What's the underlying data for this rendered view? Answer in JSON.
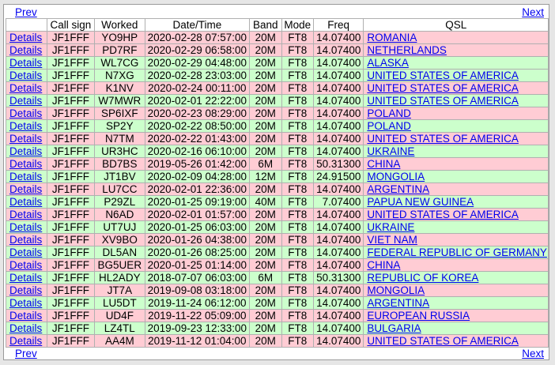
{
  "nav": {
    "prev_label": "Prev",
    "next_label": "Next"
  },
  "columns": [
    "",
    "Call sign",
    "Worked",
    "Date/Time",
    "Band",
    "Mode",
    "Freq",
    "QSL"
  ],
  "row_colors": {
    "pink": "#ffccd4",
    "green": "#ccffcc",
    "link": "#0000ee"
  },
  "rows": [
    {
      "details": "Details",
      "call": "JF1FFF",
      "worked": "YO9HP",
      "datetime": "2020-02-28 07:57:00",
      "band": "20M",
      "mode": "FT8",
      "freq": "14.07400",
      "qsl": "ROMANIA",
      "color": "pink"
    },
    {
      "details": "Details",
      "call": "JF1FFF",
      "worked": "PD7RF",
      "datetime": "2020-02-29 06:58:00",
      "band": "20M",
      "mode": "FT8",
      "freq": "14.07400",
      "qsl": "NETHERLANDS",
      "color": "pink"
    },
    {
      "details": "Details",
      "call": "JF1FFF",
      "worked": "WL7CG",
      "datetime": "2020-02-29 04:48:00",
      "band": "20M",
      "mode": "FT8",
      "freq": "14.07400",
      "qsl": "ALASKA",
      "color": "green"
    },
    {
      "details": "Details",
      "call": "JF1FFF",
      "worked": "N7XG",
      "datetime": "2020-02-28 23:03:00",
      "band": "20M",
      "mode": "FT8",
      "freq": "14.07400",
      "qsl": "UNITED STATES OF AMERICA",
      "color": "green"
    },
    {
      "details": "Details",
      "call": "JF1FFF",
      "worked": "K1NV",
      "datetime": "2020-02-24 00:11:00",
      "band": "20M",
      "mode": "FT8",
      "freq": "14.07400",
      "qsl": "UNITED STATES OF AMERICA",
      "color": "pink"
    },
    {
      "details": "Details",
      "call": "JF1FFF",
      "worked": "W7MWR",
      "datetime": "2020-02-01 22:22:00",
      "band": "20M",
      "mode": "FT8",
      "freq": "14.07400",
      "qsl": "UNITED STATES OF AMERICA",
      "color": "green"
    },
    {
      "details": "Details",
      "call": "JF1FFF",
      "worked": "SP6IXF",
      "datetime": "2020-02-23 08:29:00",
      "band": "20M",
      "mode": "FT8",
      "freq": "14.07400",
      "qsl": "POLAND",
      "color": "pink"
    },
    {
      "details": "Details",
      "call": "JF1FFF",
      "worked": "SP2Y",
      "datetime": "2020-02-22 08:50:00",
      "band": "20M",
      "mode": "FT8",
      "freq": "14.07400",
      "qsl": "POLAND",
      "color": "green"
    },
    {
      "details": "Details",
      "call": "JF1FFF",
      "worked": "N7TM",
      "datetime": "2020-02-22 01:43:00",
      "band": "20M",
      "mode": "FT8",
      "freq": "14.07400",
      "qsl": "UNITED STATES OF AMERICA",
      "color": "pink"
    },
    {
      "details": "Details",
      "call": "JF1FFF",
      "worked": "UR3HC",
      "datetime": "2020-02-16 06:10:00",
      "band": "20M",
      "mode": "FT8",
      "freq": "14.07400",
      "qsl": "UKRAINE",
      "color": "green"
    },
    {
      "details": "Details",
      "call": "JF1FFF",
      "worked": "BD7BS",
      "datetime": "2019-05-26 01:42:00",
      "band": "6M",
      "mode": "FT8",
      "freq": "50.31300",
      "qsl": "CHINA",
      "color": "pink"
    },
    {
      "details": "Details",
      "call": "JF1FFF",
      "worked": "JT1BV",
      "datetime": "2020-02-09 04:28:00",
      "band": "12M",
      "mode": "FT8",
      "freq": "24.91500",
      "qsl": "MONGOLIA",
      "color": "green"
    },
    {
      "details": "Details",
      "call": "JF1FFF",
      "worked": "LU7CC",
      "datetime": "2020-02-01 22:36:00",
      "band": "20M",
      "mode": "FT8",
      "freq": "14.07400",
      "qsl": "ARGENTINA",
      "color": "pink"
    },
    {
      "details": "Details",
      "call": "JF1FFF",
      "worked": "P29ZL",
      "datetime": "2020-01-25 09:19:00",
      "band": "40M",
      "mode": "FT8",
      "freq": "7.07400",
      "qsl": "PAPUA NEW GUINEA",
      "color": "green"
    },
    {
      "details": "Details",
      "call": "JF1FFF",
      "worked": "N6AD",
      "datetime": "2020-02-01 01:57:00",
      "band": "20M",
      "mode": "FT8",
      "freq": "14.07400",
      "qsl": "UNITED STATES OF AMERICA",
      "color": "pink"
    },
    {
      "details": "Details",
      "call": "JF1FFF",
      "worked": "UT7UJ",
      "datetime": "2020-01-25 06:03:00",
      "band": "20M",
      "mode": "FT8",
      "freq": "14.07400",
      "qsl": "UKRAINE",
      "color": "green"
    },
    {
      "details": "Details",
      "call": "JF1FFF",
      "worked": "XV9BO",
      "datetime": "2020-01-26 04:38:00",
      "band": "20M",
      "mode": "FT8",
      "freq": "14.07400",
      "qsl": "VIET NAM",
      "color": "pink"
    },
    {
      "details": "Details",
      "call": "JF1FFF",
      "worked": "DL5AN",
      "datetime": "2020-01-26 08:25:00",
      "band": "20M",
      "mode": "FT8",
      "freq": "14.07400",
      "qsl": "FEDERAL REPUBLIC OF GERMANY",
      "color": "green"
    },
    {
      "details": "Details",
      "call": "JF1FFF",
      "worked": "BG5UER",
      "datetime": "2020-01-25 01:14:00",
      "band": "20M",
      "mode": "FT8",
      "freq": "14.07400",
      "qsl": "CHINA",
      "color": "pink"
    },
    {
      "details": "Details",
      "call": "JF1FFF",
      "worked": "HL2ADY",
      "datetime": "2018-07-07 06:03:00",
      "band": "6M",
      "mode": "FT8",
      "freq": "50.31300",
      "qsl": "REPUBLIC OF KOREA",
      "color": "green"
    },
    {
      "details": "Details",
      "call": "JF1FFF",
      "worked": "JT7A",
      "datetime": "2019-09-08 03:18:00",
      "band": "20M",
      "mode": "FT8",
      "freq": "14.07400",
      "qsl": "MONGOLIA",
      "color": "pink"
    },
    {
      "details": "Details",
      "call": "JF1FFF",
      "worked": "LU5DT",
      "datetime": "2019-11-24 06:12:00",
      "band": "20M",
      "mode": "FT8",
      "freq": "14.07400",
      "qsl": "ARGENTINA",
      "color": "green"
    },
    {
      "details": "Details",
      "call": "JF1FFF",
      "worked": "UD4F",
      "datetime": "2019-11-22 05:09:00",
      "band": "20M",
      "mode": "FT8",
      "freq": "14.07400",
      "qsl": "EUROPEAN RUSSIA",
      "color": "pink"
    },
    {
      "details": "Details",
      "call": "JF1FFF",
      "worked": "LZ4TL",
      "datetime": "2019-09-23 12:33:00",
      "band": "20M",
      "mode": "FT8",
      "freq": "14.07400",
      "qsl": "BULGARIA",
      "color": "green"
    },
    {
      "details": "Details",
      "call": "JF1FFF",
      "worked": "AA4M",
      "datetime": "2019-11-12 01:04:00",
      "band": "20M",
      "mode": "FT8",
      "freq": "14.07400",
      "qsl": "UNITED STATES OF AMERICA",
      "color": "pink"
    }
  ]
}
